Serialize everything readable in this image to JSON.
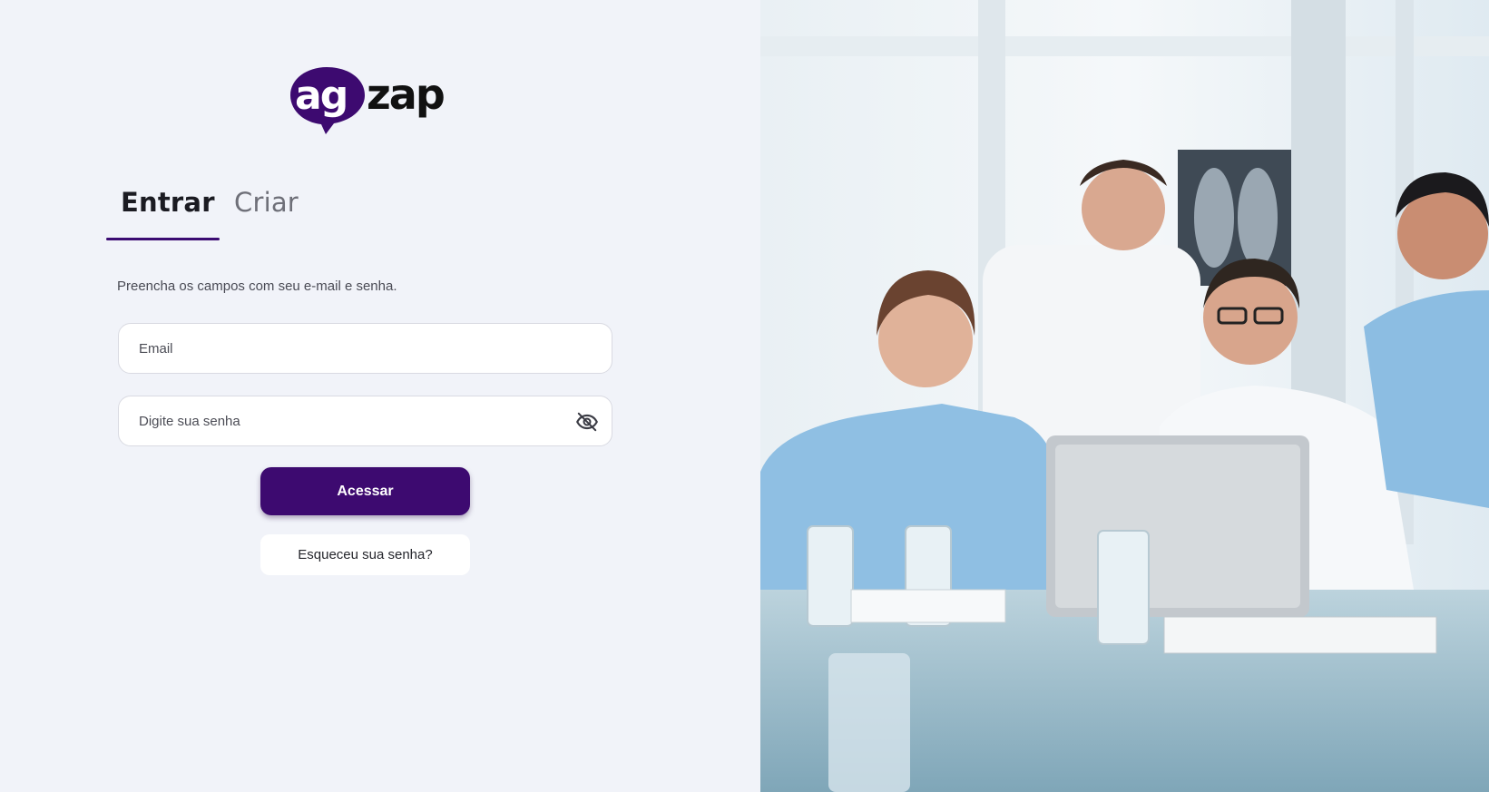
{
  "brand": {
    "logo_text_left": "ag",
    "logo_text_right": "zap",
    "accent_color": "#3d0a70"
  },
  "tabs": [
    {
      "label": "Entrar",
      "active": true
    },
    {
      "label": "Criar",
      "active": false
    }
  ],
  "login": {
    "instruction": "Preencha os campos com seu e-mail e senha.",
    "email_placeholder": "Email",
    "email_value": "",
    "password_placeholder": "Digite sua senha",
    "password_value": "",
    "password_toggle_icon": "eye-off-icon",
    "submit_label": "Acessar",
    "forgot_label": "Esqueceu sua senha?"
  },
  "hero": {
    "image_subject": "medical-team-photo"
  }
}
